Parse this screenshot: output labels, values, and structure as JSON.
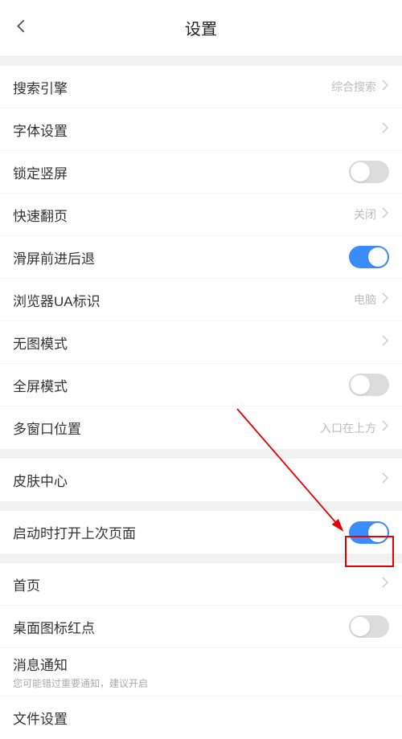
{
  "header": {
    "title": "设置"
  },
  "group1": {
    "search_engine": {
      "label": "搜索引擎",
      "value": "综合搜索"
    },
    "font_settings": {
      "label": "字体设置"
    },
    "lock_portrait": {
      "label": "锁定竖屏",
      "on": false
    },
    "quick_flip": {
      "label": "快速翻页",
      "value": "关闭"
    },
    "swipe_nav": {
      "label": "滑屏前进后退",
      "on": true
    },
    "ua": {
      "label": "浏览器UA标识",
      "value": "电脑"
    },
    "no_image": {
      "label": "无图模式"
    },
    "fullscreen": {
      "label": "全屏模式",
      "on": false
    },
    "multi_window": {
      "label": "多窗口位置",
      "value": "入口在上方"
    }
  },
  "group2": {
    "skin_center": {
      "label": "皮肤中心"
    }
  },
  "group3": {
    "restore_last": {
      "label": "启动时打开上次页面",
      "on": true
    }
  },
  "group4": {
    "homepage": {
      "label": "首页"
    },
    "badge": {
      "label": "桌面图标红点",
      "on": false
    },
    "notifications": {
      "label": "消息通知",
      "sub": "您可能错过重要通知，建议开启"
    },
    "file_settings": {
      "label": "文件设置"
    }
  }
}
